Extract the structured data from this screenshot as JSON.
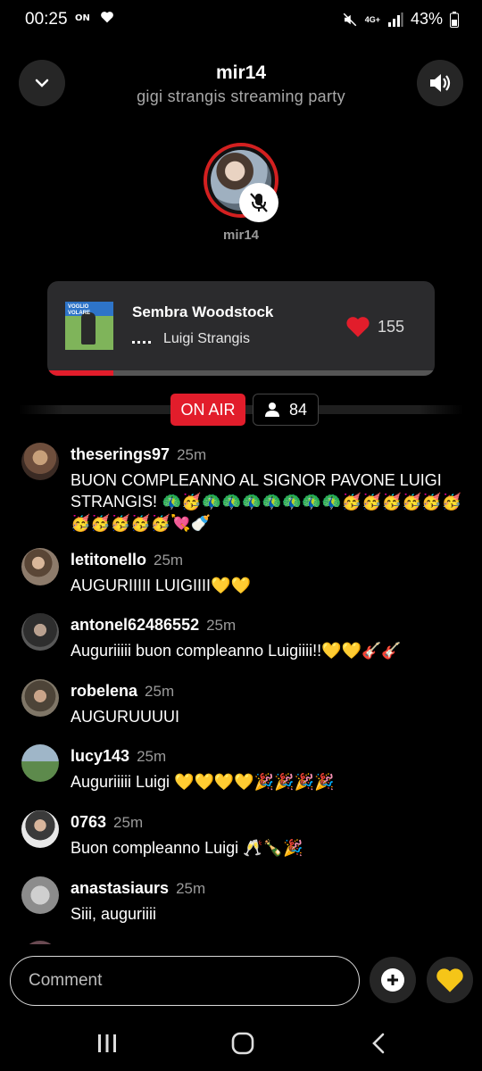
{
  "status_bar": {
    "time": "00:25",
    "battery": "43%",
    "network": "4G+"
  },
  "header": {
    "host": "mir14",
    "room_title": "gigi strangis streaming party"
  },
  "host": {
    "name": "mir14",
    "muted": true
  },
  "now_playing": {
    "title": "Sembra Woodstock",
    "artist": "Luigi Strangis",
    "likes": "155",
    "progress": 0.17,
    "cover_label": "VOGLIO VOLARE"
  },
  "live": {
    "on_air_label": "ON AIR",
    "listener_count": "84"
  },
  "comments": [
    {
      "user": "theserings97",
      "time": "25m",
      "text": "BUON COMPLEANNO AL SIGNOR PAVONE LUIGI STRANGIS! 🦚🥳🦚🦚🦚🦚🦚🦚🦚🥳🥳🥳🥳🥳🥳🥳🥳🥳🥳🥳💘🍼"
    },
    {
      "user": "letitonello",
      "time": "25m",
      "text": "AUGURIIIII LUIGIIII💛💛"
    },
    {
      "user": "antonel62486552",
      "time": "25m",
      "text": "Auguriiiii buon compleanno Luigiiii!!💛💛🎸🎸"
    },
    {
      "user": "robelena",
      "time": "25m",
      "text": "AUGURUUUUI"
    },
    {
      "user": "lucy143",
      "time": "25m",
      "text": "Auguriiiii Luigi 💛💛💛💛🎉🎉🎉🎉"
    },
    {
      "user": "0763",
      "time": "25m",
      "text": "Buon compleanno Luigi 🥂🍾🎉"
    },
    {
      "user": "anastasiaurs",
      "time": "25m",
      "text": "Siii, auguriiii"
    }
  ],
  "comment_input": {
    "placeholder": "Comment"
  },
  "colors": {
    "accent_red": "#e21d2b",
    "card_bg": "#2b2b2d",
    "heart_yellow": "#f5c518"
  }
}
